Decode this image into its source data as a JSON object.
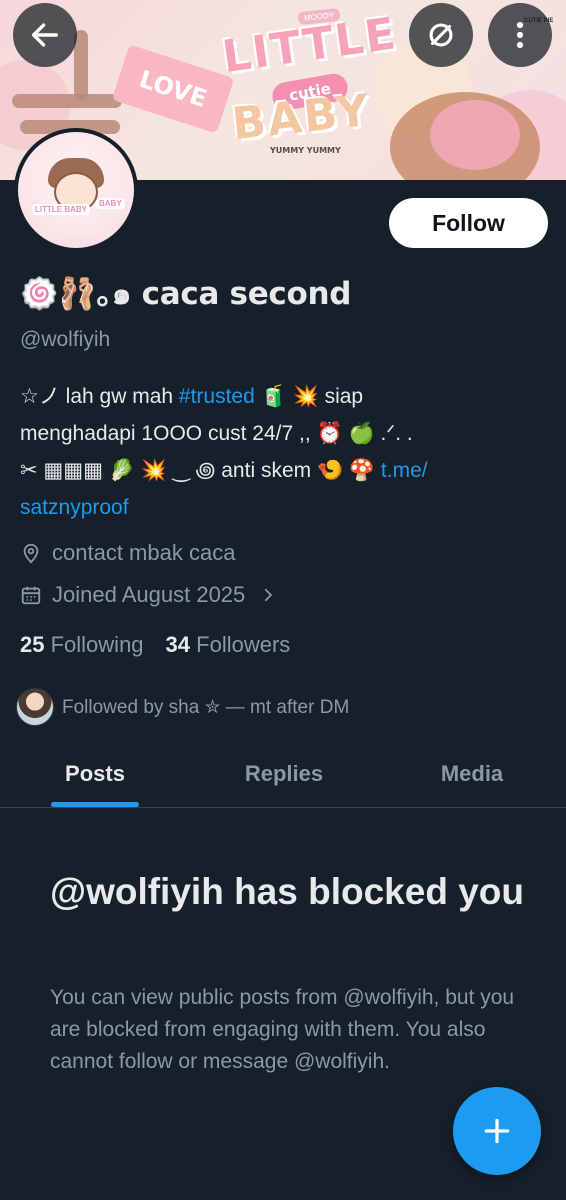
{
  "header": {
    "back_icon": "arrow-left-icon",
    "sync_icon": "sync-off-icon",
    "more_icon": "more-vertical-icon",
    "banner_art": {
      "love": "LOVE",
      "little": "LITTLE",
      "cutie": "cutie",
      "baby": "BABY",
      "yummy": "YUMMY YUMMY",
      "mood": "MOODY",
      "pie": "CUTIE PIE"
    }
  },
  "profile": {
    "avatar_tags": [
      "LITTLE BABY",
      "BABY"
    ],
    "follow_label": "Follow",
    "display_name": "🍥🩰｡๑ caca second",
    "handle": "@wolfiyih",
    "bio": {
      "line1_a": "☆ノ lah gw mah ",
      "line1_hashtag": "#trusted",
      "line1_b": " 🧃 💥 siap",
      "line2": "menghadapi 1OOO cust 24/7 ,, ⏰ 🍏 .ᐟ. .",
      "line3_a": "✂ ▦▦▦ 🥬 💥 ‿ ꩜ anti skem 🍤 🍄 ",
      "line3_link": "t.me/",
      "line4_link": "satznyproof"
    },
    "location_icon": "location-pin-icon",
    "location": "contact mbak caca",
    "calendar_icon": "calendar-icon",
    "joined": "Joined August 2025",
    "following_count": "25",
    "following_label": "Following",
    "followers_count": "34",
    "followers_label": "Followers",
    "followed_by": "Followed by sha ✮ — mt after DM"
  },
  "tabs": {
    "posts": "Posts",
    "replies": "Replies",
    "media": "Media"
  },
  "blocked": {
    "title": "@wolfiyih has blocked you",
    "description": "You can view public posts from @wolfiyih, but you are blocked from engaging with them. You also cannot follow or message @wolfiyih."
  },
  "fab": {
    "icon": "plus-icon"
  },
  "colors": {
    "background": "#15202b",
    "accent": "#1d9bf0",
    "muted_text": "#8b98a5",
    "primary_text": "#e7e9ea"
  }
}
